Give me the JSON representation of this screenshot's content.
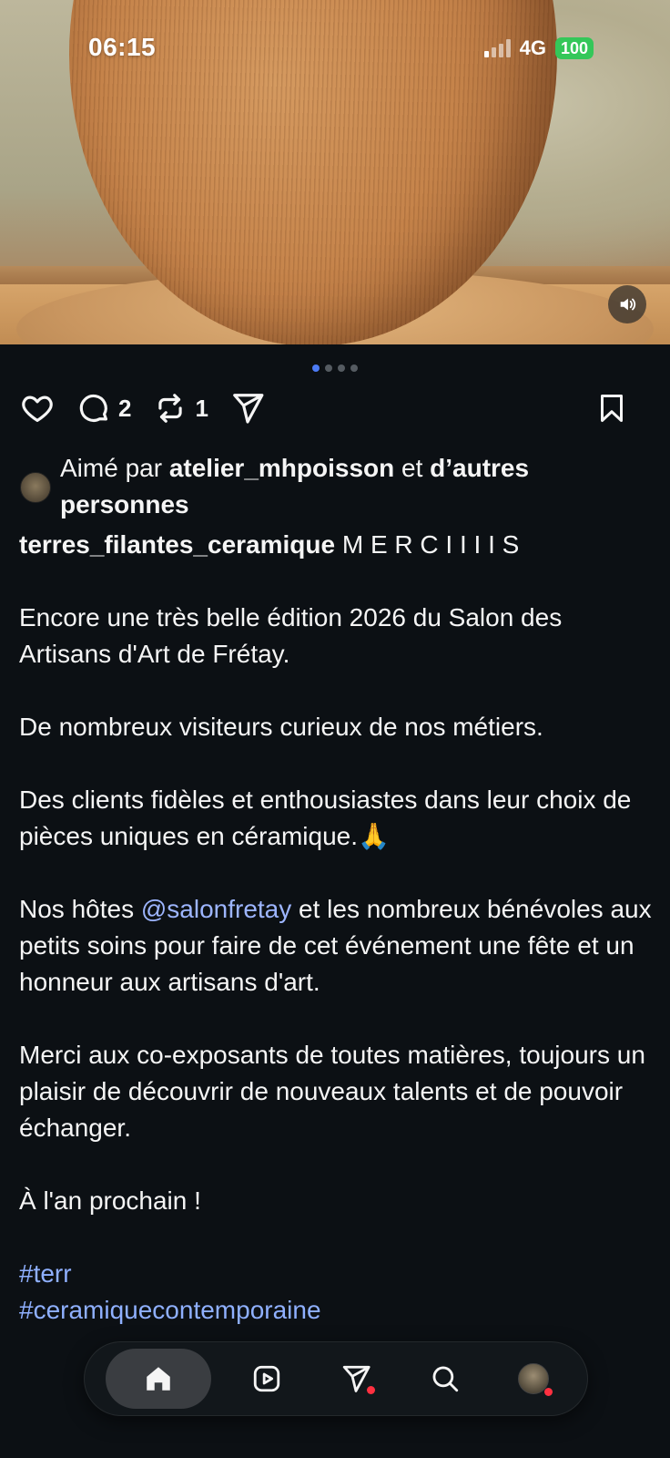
{
  "status_bar": {
    "time": "06:15",
    "network": "4G",
    "battery": "100"
  },
  "carousel": {
    "total": 4,
    "active": 1
  },
  "actions": {
    "comments_count": "2",
    "reposts_count": "1"
  },
  "likes": {
    "prefix": "Aimé par",
    "user": "atelier_mhpoisson",
    "connector": "et",
    "others": "d’autres personnes"
  },
  "post": {
    "username": "terres_filantes_ceramique",
    "headline": "M E R C I I I I S",
    "paragraphs": [
      "Encore une très belle édition 2026 du Salon des Artisans d'Art de Frétay.",
      "De nombreux visiteurs curieux de nos métiers.",
      "Des clients fidèles et enthousiastes dans leur choix de pièces uniques en céramique.🙏"
    ],
    "hosts_before": "Nos hôtes",
    "hosts_mention": "@salonfretay",
    "hosts_after": "et les nombreux bénévoles aux petits soins pour faire de cet événement une fête et un honneur aux artisans d'art.",
    "thanks": "Merci aux co-exposants de toutes matières, toujours un plaisir de découvrir de nouveaux talents et de pouvoir échanger.",
    "closing": "À l'an prochain !",
    "hashtag_1": "#terr",
    "hashtag_2": "#ceramiquecontemporaine"
  },
  "colors": {
    "background": "#0c1014",
    "link": "#9db5ff",
    "active_dot": "#4c7bf5",
    "notification": "#ff3040",
    "battery": "#34c759"
  },
  "icons": {
    "like": "heart-icon",
    "comment": "comment-bubble-icon",
    "repost": "repost-icon",
    "share": "send-icon",
    "save": "bookmark-icon",
    "nav_home": "home-icon",
    "nav_reels": "reels-icon",
    "nav_messages": "send-icon",
    "nav_search": "search-icon"
  }
}
